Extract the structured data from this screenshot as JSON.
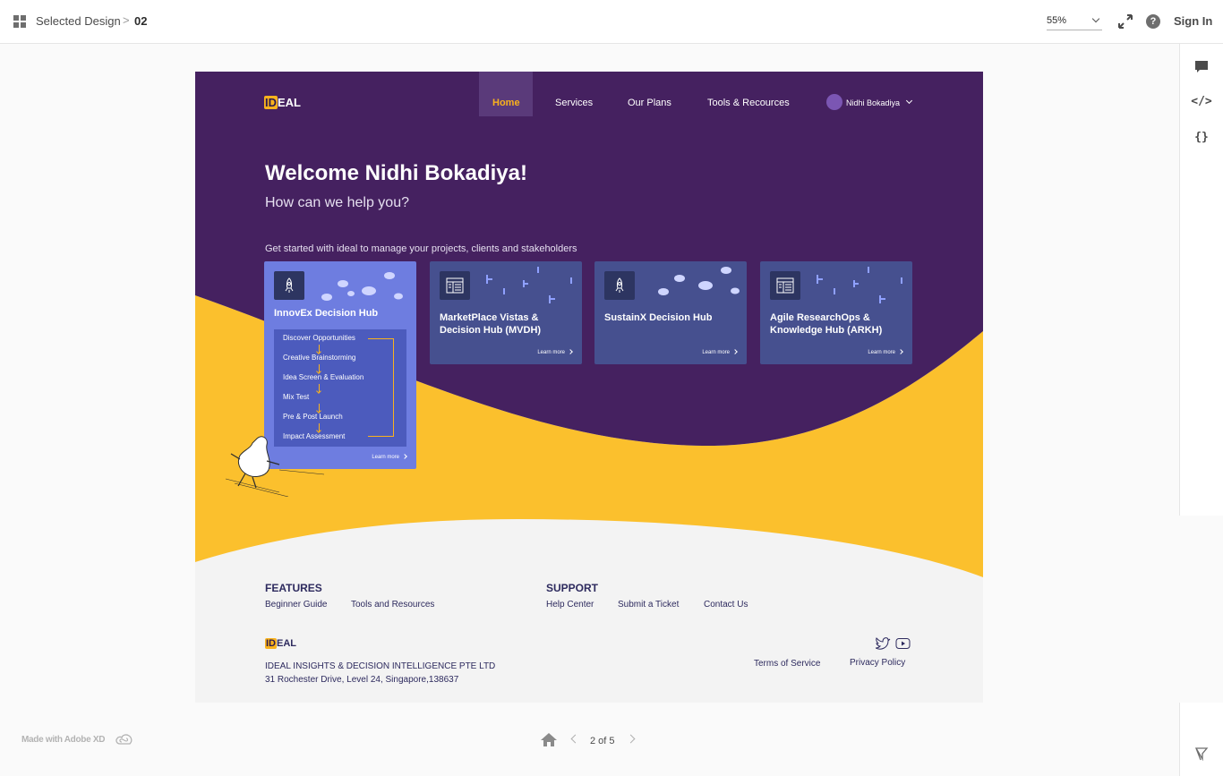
{
  "viewer": {
    "breadcrumb_parent": "Selected Design",
    "breadcrumb_separator": ">",
    "breadcrumb_current": "02",
    "zoom": "55%",
    "help": "?",
    "sign_in": "Sign In",
    "made_with": "Made with Adobe XD",
    "pager": "2 of 5",
    "rail_code": "</>",
    "rail_braces": "{}"
  },
  "site": {
    "logo_id": "ID",
    "logo_rest": "EAL",
    "nav": {
      "home": "Home",
      "services": "Services",
      "plans": "Our Plans",
      "tools": "Tools & Recources"
    },
    "user_name": "Nidhi Bokadiya",
    "welcome": "Welcome Nidhi Bokadiya!",
    "subtitle": "How can we help you?",
    "get_started": "Get started with ideal to manage your projects, clients and stakeholders",
    "learn_more": "Learn more",
    "cards": [
      {
        "title": "InnovEx Decision Hub",
        "icon": "rocket-icon"
      },
      {
        "title": "MarketPlace Vistas & Decision Hub (MVDH)",
        "icon": "layout-icon"
      },
      {
        "title": "SustainX Decision Hub",
        "icon": "rocket-icon"
      },
      {
        "title": "Agile  ResearchOps & Knowledge Hub (ARKH)",
        "icon": "layout-icon"
      }
    ],
    "steps": [
      "Discover Opportunities",
      "Creative Brainstorming",
      "Idea Screen & Evaluation",
      "Mix Test",
      "Pre & Post Launch",
      "Impact Assessment"
    ],
    "footer": {
      "features_heading": "FEATURES",
      "features_links": [
        "Beginner Guide",
        "Tools and Resources"
      ],
      "support_heading": "SUPPORT",
      "support_links": [
        "Help Center",
        "Submit a Ticket",
        "Contact Us"
      ],
      "company_name": "IDEAL INSIGHTS & DECISION INTELLIGENCE PTE LTD",
      "address": "31 Rochester Drive, Level 24, Singapore,138637",
      "terms": "Terms of Service",
      "privacy": "Privacy Policy"
    }
  },
  "colors": {
    "purple": "#452160",
    "yellow": "#fbc02d",
    "card": "#46508f",
    "card_highlight": "#6e7de0",
    "accent": "#f9b21d",
    "footer_bg": "#f3f3f3"
  }
}
